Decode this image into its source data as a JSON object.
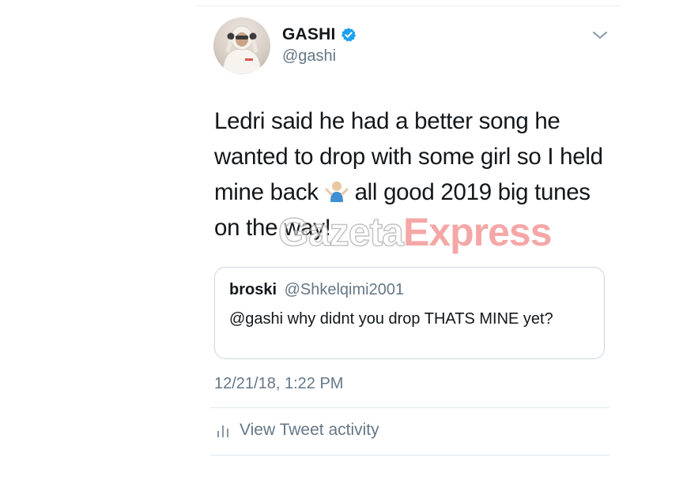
{
  "author": {
    "display_name": "GASHI",
    "handle": "@gashi",
    "verified": true
  },
  "tweet": {
    "text_line_1": "Ledri said he had a better song he",
    "text_line_2": "wanted to drop with some girl so I held",
    "text_line_3a": "mine back",
    "text_line_3b": "all good 2019 big tunes",
    "text_line_4": "on the way!",
    "emoji": "person-shrugging-emoji",
    "timestamp": "12/21/18, 1:22 PM"
  },
  "quoted_tweet": {
    "name": "broski",
    "handle": "@Shkelqimi2001",
    "text": "@gashi why didnt you drop THATS MINE yet?"
  },
  "actions": {
    "view_activity_label": "View Tweet activity"
  },
  "watermark": {
    "part_1": "Gazeta",
    "part_2": "Express"
  },
  "colors": {
    "text": "#14171a",
    "secondary": "#657786",
    "verified": "#1da1f2",
    "border": "#ccd6dd"
  },
  "icons": [
    "verified-badge-icon",
    "chevron-down-icon",
    "bar-chart-icon"
  ]
}
